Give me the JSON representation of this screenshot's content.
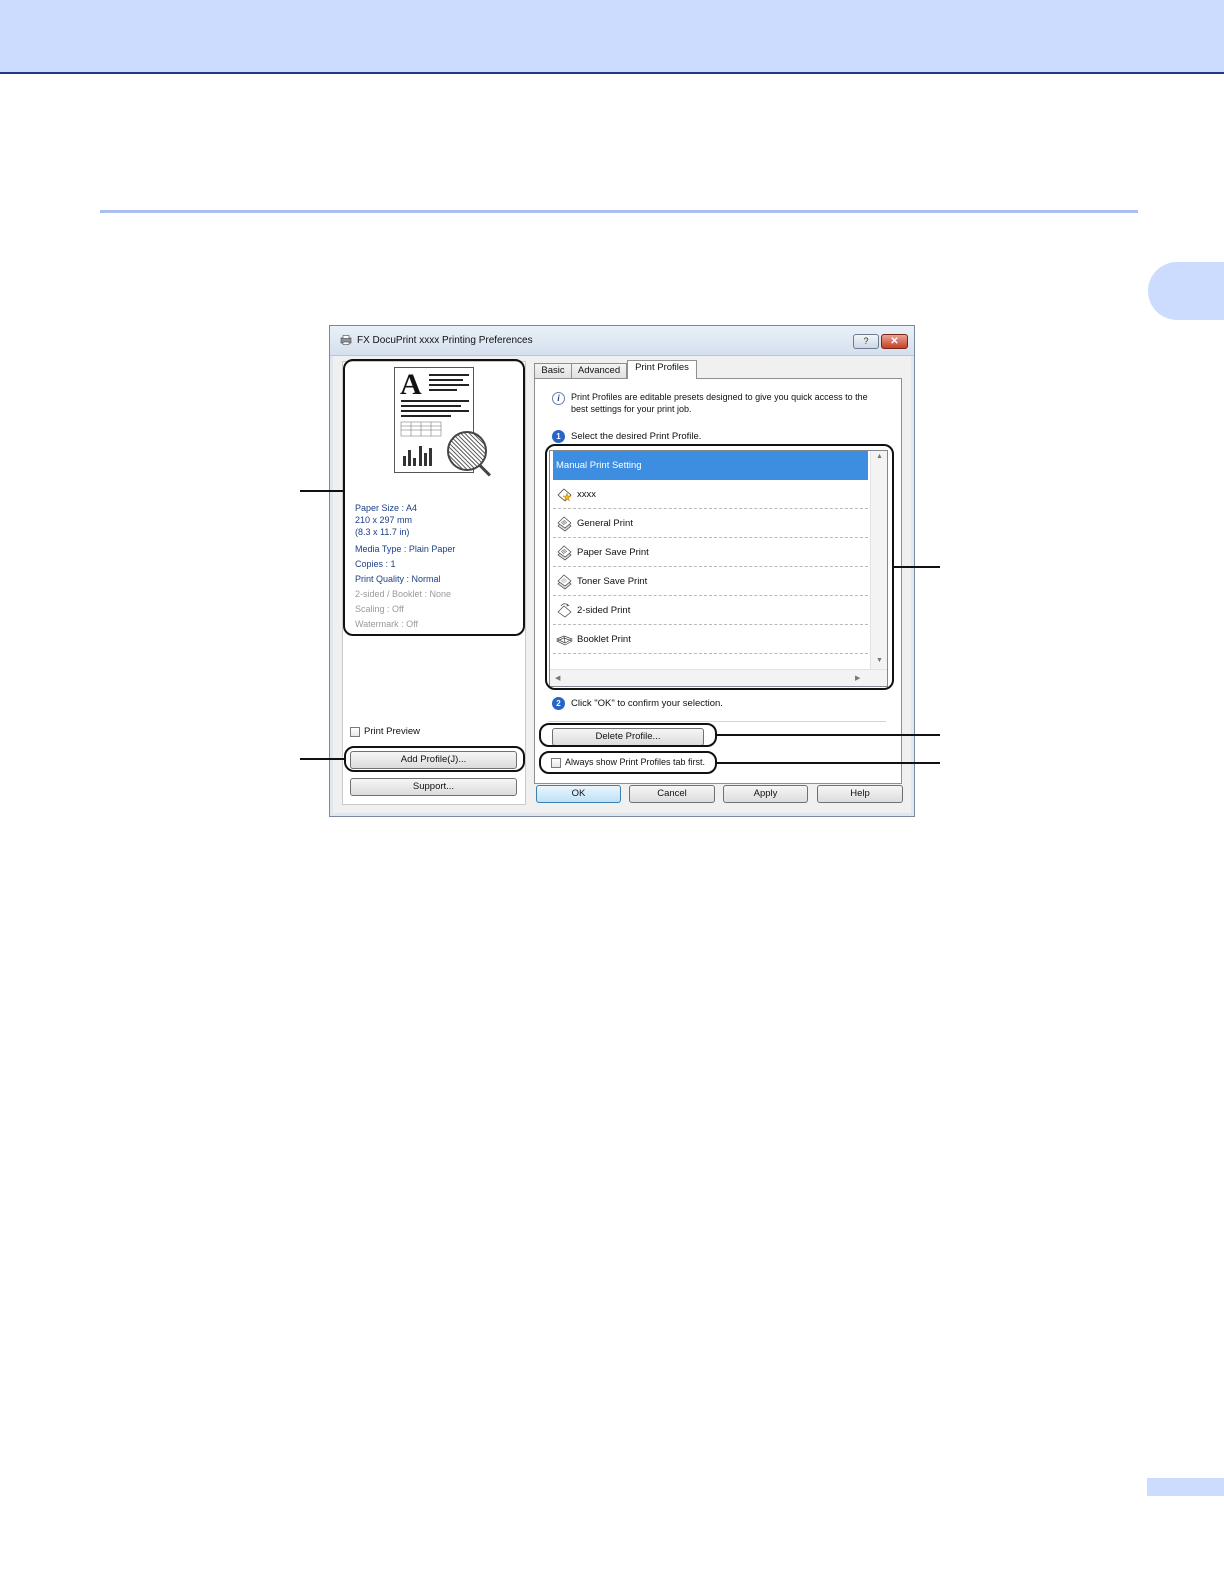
{
  "dialog": {
    "title": "FX DocuPrint xxxx   Printing Preferences",
    "help_button": "?",
    "close_button": "✕"
  },
  "preview": {
    "letter": "A",
    "info": [
      {
        "text": "Paper Size : A4",
        "state": "active"
      },
      {
        "text": "210 x 297 mm",
        "state": "active"
      },
      {
        "text": "(8.3 x 11.7 in)",
        "state": "active"
      },
      {
        "text": "Media Type : Plain Paper",
        "state": "active"
      },
      {
        "text": "Copies : 1",
        "state": "active"
      },
      {
        "text": "Print Quality : Normal",
        "state": "active"
      },
      {
        "text": "2-sided / Booklet : None",
        "state": "disabled"
      },
      {
        "text": "Scaling : Off",
        "state": "disabled"
      },
      {
        "text": "Watermark : Off",
        "state": "disabled"
      }
    ]
  },
  "left_controls": {
    "print_preview_label": "Print Preview",
    "print_preview_checked": false,
    "add_profile_label": "Add Profile(J)...",
    "support_label": "Support..."
  },
  "tabs": [
    {
      "label": "Basic",
      "active": false
    },
    {
      "label": "Advanced",
      "active": false
    },
    {
      "label": "Print Profiles",
      "active": true
    }
  ],
  "profiles_tab": {
    "description_line1": "Print Profiles are editable presets designed to give you quick access to the",
    "description_line2": "best settings for your print job.",
    "step1_number": "1",
    "step1_label": "Select the desired Print Profile.",
    "profiles": [
      {
        "label": "Manual Print Setting",
        "selected": true,
        "icon": ""
      },
      {
        "label": "xxxx",
        "selected": false,
        "icon": "star-document-icon"
      },
      {
        "label": "General Print",
        "selected": false,
        "icon": "document-stack-icon"
      },
      {
        "label": "Paper Save Print",
        "selected": false,
        "icon": "document-stack-icon"
      },
      {
        "label": "Toner Save Print",
        "selected": false,
        "icon": "document-stack-icon"
      },
      {
        "label": "2-sided Print",
        "selected": false,
        "icon": "two-sided-icon"
      },
      {
        "label": "Booklet Print",
        "selected": false,
        "icon": "booklet-icon"
      }
    ],
    "step2_number": "2",
    "step2_label": "Click \"OK\" to confirm your selection.",
    "delete_profile_label": "Delete Profile...",
    "always_show_label": "Always show Print Profiles tab first.",
    "always_show_checked": false
  },
  "footer_buttons": {
    "ok": "OK",
    "cancel": "Cancel",
    "apply": "Apply",
    "help": "Help"
  },
  "colors": {
    "selection": "#3d8ee0",
    "info_text": "#1c3f86",
    "header_band": "#ccdcff"
  }
}
